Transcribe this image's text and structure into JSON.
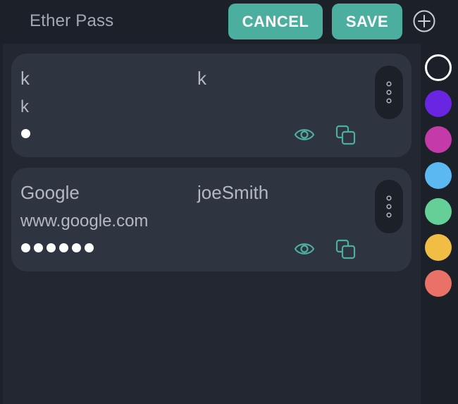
{
  "header": {
    "title": "Ether Pass",
    "cancel_label": "CANCEL",
    "save_label": "SAVE",
    "add_icon": "plus-circle-icon"
  },
  "entries": [
    {
      "name": "k",
      "username": "k",
      "url": "k",
      "password_length": 1
    },
    {
      "name": "Google",
      "username": "joeSmith",
      "url": "www.google.com",
      "password_length": 6
    }
  ],
  "entry_icons": {
    "menu": "vertical-dots-icon",
    "reveal": "eye-icon",
    "copy": "copy-icon"
  },
  "palette": {
    "selected": "#1c2028",
    "colors": [
      "#1c2028",
      "#6a25e3",
      "#c43aa8",
      "#5cb8f0",
      "#64cf97",
      "#f2bd44",
      "#ea7167"
    ]
  },
  "theme": {
    "accent": "#4cae9e",
    "background": "#1c2028",
    "card": "#2e3440"
  }
}
